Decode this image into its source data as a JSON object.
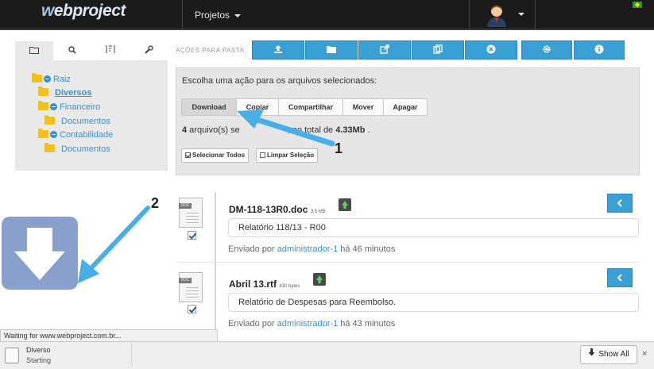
{
  "topbar": {
    "logo": "webproject",
    "logo_prefix": "w",
    "logo_rest": "ebproject",
    "nav_projetos": "Projetos",
    "avatar_icon": "user-avatar-icon",
    "flag_icon": "brazil-flag-icon"
  },
  "tree": {
    "tabs": [
      {
        "icon": "folder-open-icon",
        "glyph": "🗁"
      },
      {
        "icon": "search-icon",
        "glyph": "🔍"
      },
      {
        "icon": "sort-icon",
        "glyph": "⇅"
      },
      {
        "icon": "wrench-icon",
        "glyph": "🔧"
      }
    ],
    "nodes": {
      "raiz": "Raiz",
      "diversos": "Diversos",
      "financeiro": "Financeiro",
      "documentos1": "Documentos",
      "contabilidade": "Contabilidade",
      "documentos2": "Documentos"
    }
  },
  "actions": {
    "label": "AÇÕES PARA PASTA:",
    "buttons": [
      {
        "icon": "upload-icon",
        "glyph": "⬆"
      },
      {
        "icon": "folder-icon",
        "glyph": "▬"
      },
      {
        "icon": "share-icon",
        "glyph": "⇪"
      },
      {
        "icon": "copy-icon",
        "glyph": "❐"
      },
      {
        "icon": "remove-icon",
        "glyph": "✖"
      },
      {
        "icon": "gear-icon",
        "glyph": "⚙"
      },
      {
        "icon": "info-icon",
        "glyph": "ℹ"
      }
    ]
  },
  "panel": {
    "prompt": "Escolha uma ação para os arquivos selecionados:",
    "buttons": {
      "download": "Download",
      "copiar": "Copiar",
      "compartilhar": "Compartilhar",
      "mover": "Mover",
      "apagar": "Apagar"
    },
    "count_num": "4",
    "count_mid": " arquivo(s) se",
    "count_hidden": "lecionado(s)",
    "count_tail": ", no total de ",
    "total": "4.33Mb",
    "period": " .",
    "select_all": "Selecionar Todos",
    "clear_selection": "Limpar Seleção"
  },
  "files": [
    {
      "name": "DM-118-13R0.doc",
      "size": "3,5 MB",
      "description": "Relatório 118/13 - R00",
      "sent_prefix": "Enviado por ",
      "user": "administrador-1",
      "ago": " há 46 minutos",
      "type_label": "DOC"
    },
    {
      "name": "Abril 13.rtf",
      "size": "830 bytes",
      "description": "Relatório de Despesas para Reembolso.",
      "sent_prefix": "Enviado por ",
      "user": "administrador-1",
      "ago": " há 43 minutos",
      "type_label": "DOC"
    }
  ],
  "annotations": {
    "marker1": "1",
    "marker2": "2"
  },
  "browser": {
    "status": "Waiting for www.webproject.com.br...",
    "download_name": "Diverso",
    "download_status": "Starting",
    "show_all": "Show All",
    "close": "×"
  },
  "colors": {
    "accent": "#3a9fd3",
    "topbar": "#1b1b1b",
    "arrow": "#4aaee6"
  }
}
